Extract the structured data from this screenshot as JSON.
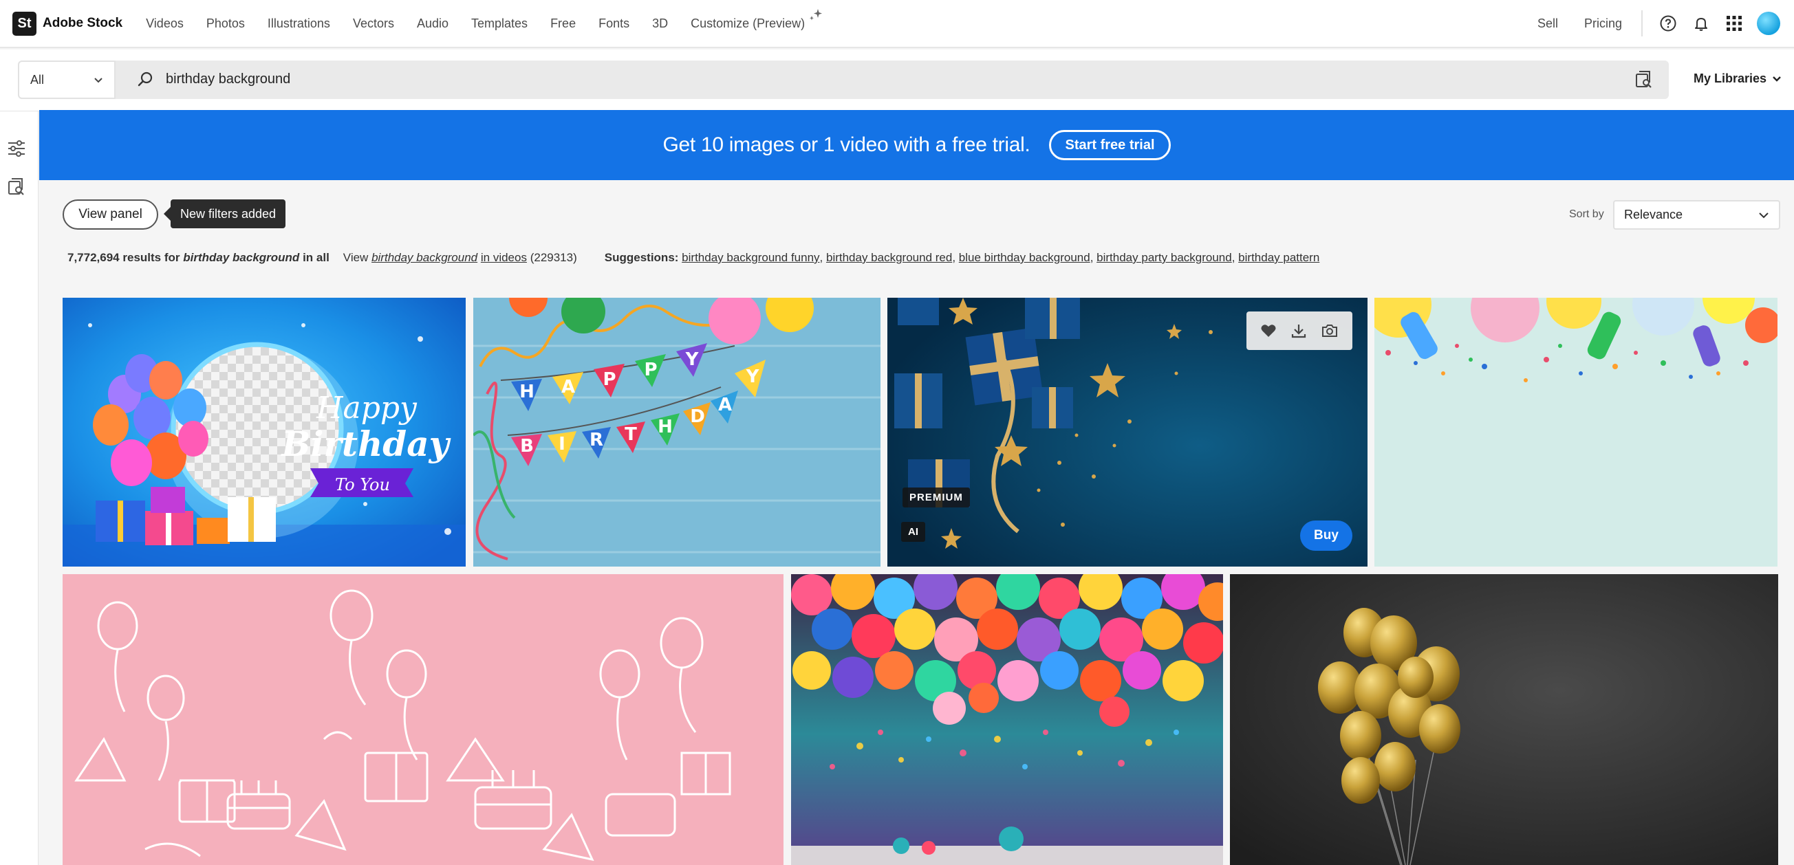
{
  "header": {
    "logo_badge": "St",
    "logo_text": "Adobe Stock",
    "nav": [
      "Videos",
      "Photos",
      "Illustrations",
      "Vectors",
      "Audio",
      "Templates",
      "Free",
      "Fonts",
      "3D",
      "Customize (Preview)"
    ],
    "sell": "Sell",
    "pricing": "Pricing",
    "icons": [
      "help-icon",
      "bell-icon",
      "apps-grid-icon",
      "avatar"
    ]
  },
  "search": {
    "scope": "All",
    "query": "birthday background",
    "my_libraries": "My Libraries"
  },
  "banner": {
    "text": "Get 10 images or 1 video with a free trial.",
    "button": "Start free trial"
  },
  "filters": {
    "view_panel": "View panel",
    "tooltip": "New filters added",
    "sort_label": "Sort by",
    "sort_value": "Relevance"
  },
  "results": {
    "count": "7,772,694",
    "results_for": "results for",
    "query": "birthday background",
    "in_all": "in all",
    "view": "View",
    "video_link": "birthday background",
    "in_videos": "in videos",
    "video_count": "(229313)",
    "suggestions_label": "Suggestions:",
    "suggestions": [
      "birthday background funny",
      "birthday background red",
      "blue birthday background",
      "birthday party background",
      "birthday pattern"
    ]
  },
  "grid": {
    "tile1_text": [
      "Happy",
      "Birthday",
      "To You"
    ],
    "tile2_letters": [
      "H",
      "A",
      "P",
      "P",
      "Y",
      "B",
      "I",
      "R",
      "T",
      "H",
      "D",
      "A",
      "Y"
    ],
    "tile3": {
      "premium": "PREMIUM",
      "ai": "AI",
      "buy": "Buy",
      "actions": [
        "heart-icon",
        "download-icon",
        "camera-icon"
      ]
    }
  }
}
